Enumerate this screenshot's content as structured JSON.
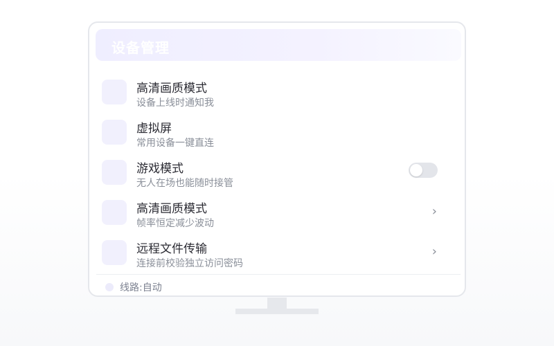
{
  "header": {
    "title": "设备管理"
  },
  "rows": [
    {
      "title": "高清画质模式",
      "subtitle": "设备上线时通知我",
      "control": "none"
    },
    {
      "title": "虚拟屏",
      "subtitle": "常用设备一键直连",
      "control": "none"
    },
    {
      "title": "游戏模式",
      "subtitle": "无人在场也能随时接管",
      "control": "toggle",
      "toggle_on": false
    },
    {
      "title": "高清画质模式",
      "subtitle": "帧率恒定减少波动",
      "control": "chevron",
      "chevron": "›"
    },
    {
      "title": "远程文件传输",
      "subtitle": "连接前校验独立访问密码",
      "control": "chevron",
      "chevron": "›"
    }
  ],
  "footer": {
    "label": "线路:自动"
  },
  "colors": {
    "accent_light": "#efeeff",
    "icon_bg": "#f1f0fd",
    "toggle_off": "#e3e5ea"
  }
}
